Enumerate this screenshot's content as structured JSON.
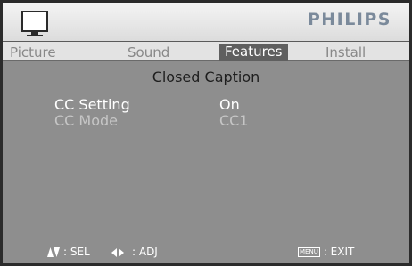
{
  "brand": "PHILIPS",
  "tabs": [
    {
      "label": "Picture",
      "active": false
    },
    {
      "label": "Sound",
      "active": false
    },
    {
      "label": "Features",
      "active": true
    },
    {
      "label": "Install",
      "active": false
    }
  ],
  "page_title": "Closed Caption",
  "settings": [
    {
      "label": "CC Setting",
      "value": "On",
      "selected": true
    },
    {
      "label": "CC Mode",
      "value": "CC1",
      "selected": false
    }
  ],
  "footer": {
    "select_icon": "up-down-arrows-icon",
    "select_label": ": SEL",
    "adjust_icon": "left-right-arrows-icon",
    "adjust_label": ": ADJ",
    "menu_key": "MENU",
    "exit_label": ": EXIT"
  },
  "colors": {
    "background": "#8e8e8e",
    "active_tab": "#5f5f5f",
    "brand": "#7b8a9b",
    "selected_text": "#ffffff",
    "dim_text": "#c6c6c6"
  }
}
